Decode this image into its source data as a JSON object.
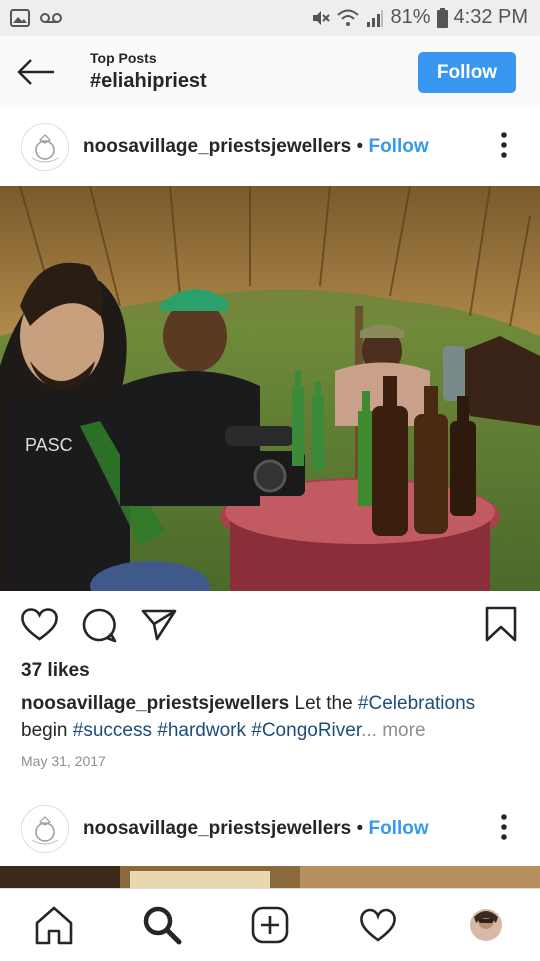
{
  "status_bar": {
    "battery": "81%",
    "time": "4:32 PM"
  },
  "header": {
    "subtitle": "Top Posts",
    "title": "#eliahipriest",
    "follow_label": "Follow"
  },
  "posts": [
    {
      "username": "noosavillage_priestsjewellers",
      "separator": "•",
      "follow_label": "Follow",
      "likes": "37 likes",
      "caption_user": "noosavillage_priestsjewellers",
      "caption_text": " Let the ",
      "tags": [
        "#Celebrations",
        "#success",
        "#hardwork",
        "#CongoRiver"
      ],
      "ellipsis": "...",
      "more": "more",
      "date": "May 31, 2017"
    },
    {
      "username": "noosavillage_priestsjewellers",
      "separator": "•",
      "follow_label": "Follow"
    }
  ],
  "icons": {
    "status_left": [
      "gallery-icon",
      "voicemail-icon"
    ],
    "status_right": [
      "mute-icon",
      "wifi-icon",
      "signal-icon",
      "battery-icon"
    ],
    "post_actions": [
      "heart-icon",
      "comment-icon",
      "share-icon",
      "bookmark-icon"
    ],
    "bottom_nav": [
      "home-icon",
      "search-icon",
      "add-icon",
      "activity-icon",
      "profile-avatar"
    ]
  },
  "colors": {
    "accent": "#3897f0",
    "hashtag": "#1c4d7a",
    "muted": "#8e8e8e"
  }
}
